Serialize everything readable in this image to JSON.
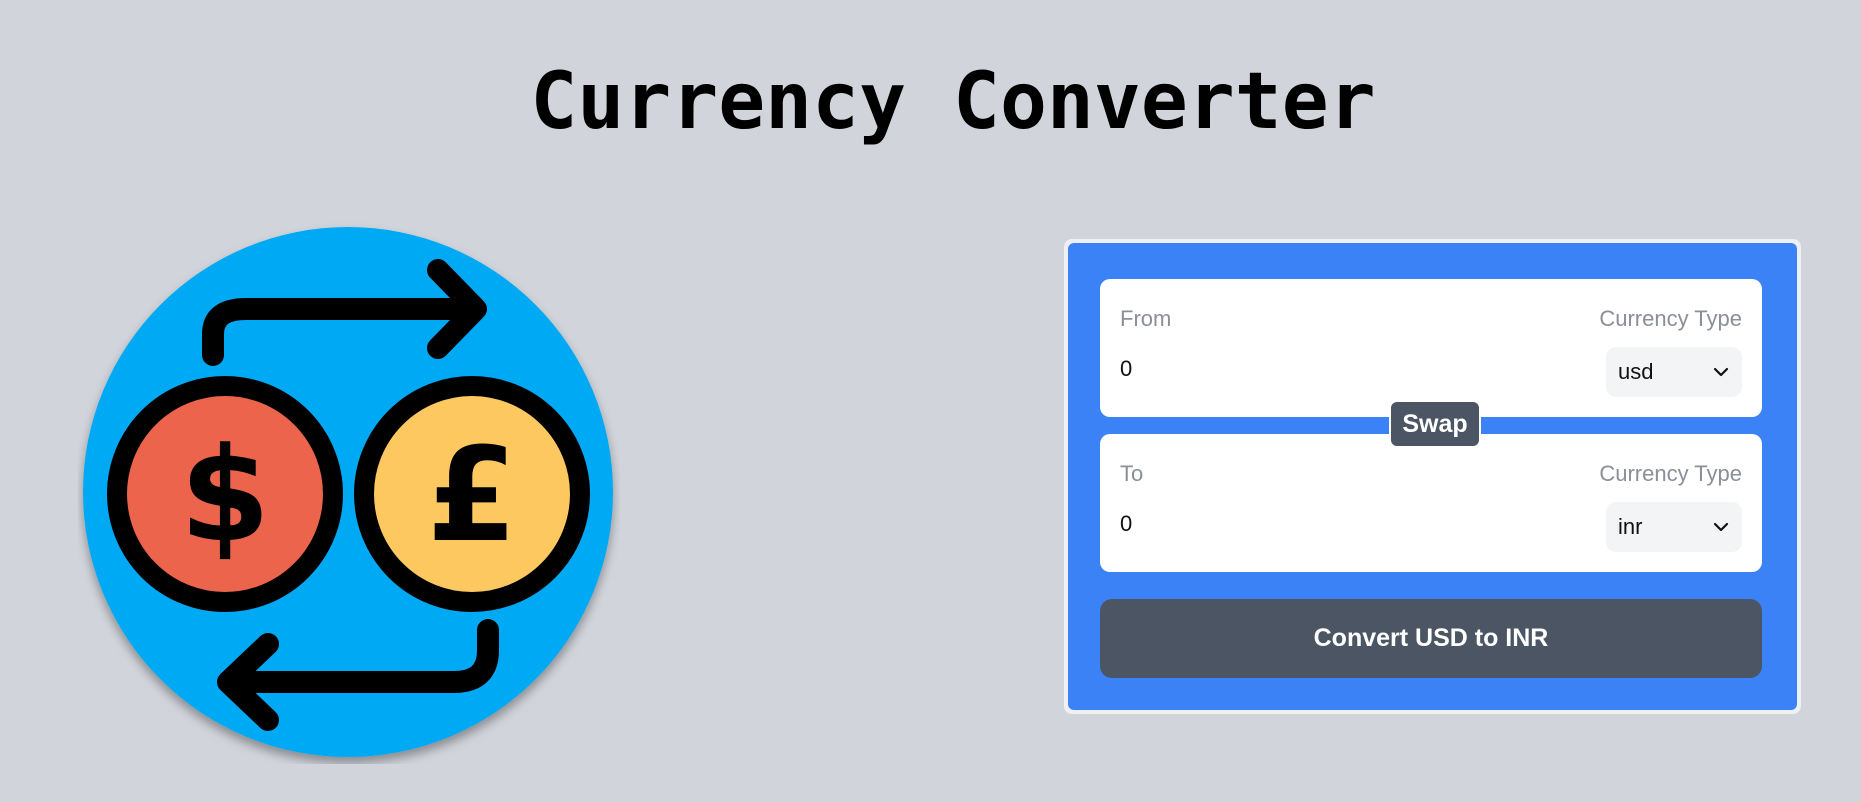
{
  "header": {
    "title": "Currency Converter"
  },
  "logo": {
    "icon": "currency-exchange-icon",
    "colors": {
      "background": "#03a9f4",
      "dollar_coin": "#ec644b",
      "pound_coin": "#fcc85f"
    }
  },
  "converter": {
    "from": {
      "label": "From",
      "currency_type_label": "Currency Type",
      "amount": "0",
      "currency": "usd"
    },
    "to": {
      "label": "To",
      "currency_type_label": "Currency Type",
      "amount": "0",
      "currency": "inr"
    },
    "swap_label": "Swap",
    "convert_label": "Convert USD to INR",
    "colors": {
      "card": "#3b82f6",
      "button": "#4b5563"
    }
  }
}
